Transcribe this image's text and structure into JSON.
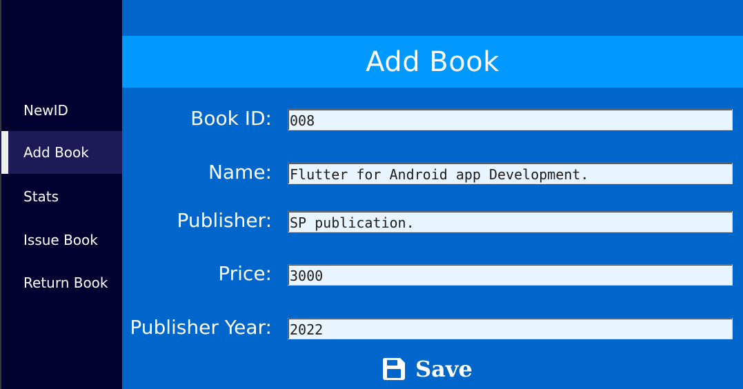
{
  "sidebar": {
    "items": [
      {
        "label": "NewID",
        "active": false
      },
      {
        "label": "Add Book",
        "active": true
      },
      {
        "label": "Stats",
        "active": false
      },
      {
        "label": "Issue Book",
        "active": false
      },
      {
        "label": "Return Book",
        "active": false
      }
    ]
  },
  "header": {
    "title": "Add Book"
  },
  "form": {
    "book_id": {
      "label": "Book ID:",
      "value": "008"
    },
    "name": {
      "label": "Name:",
      "value": "Flutter for Android app Development."
    },
    "publisher": {
      "label": "Publisher:",
      "value": "SP publication."
    },
    "price": {
      "label": "Price:",
      "value": "3000"
    },
    "publisher_year": {
      "label": "Publisher Year:",
      "value": "2022"
    }
  },
  "save_button": {
    "label": "Save",
    "icon": "floppy-disk-icon"
  },
  "colors": {
    "sidebar_bg": "#020130",
    "sidebar_active_bg": "#1d1a57",
    "main_bg": "#0066cc",
    "header_bg": "#0099ff",
    "input_bg": "#e9f5fe"
  }
}
